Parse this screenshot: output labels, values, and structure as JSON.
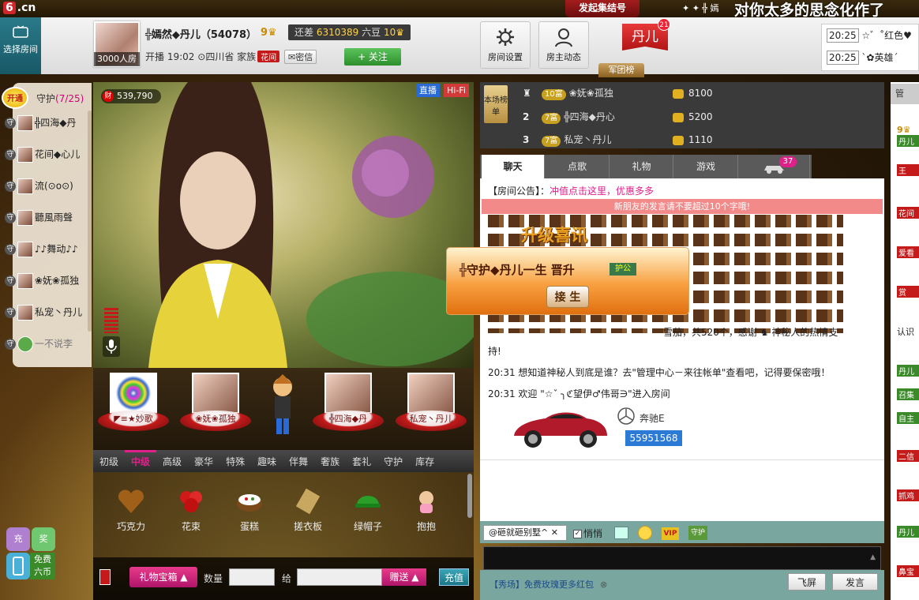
{
  "top": {
    "logo_text": ".cn",
    "rally_label": "发起集结号",
    "user_mini": "✦ ✦ ╬ 嫣",
    "marquee": "对你太多的思念化作了"
  },
  "header": {
    "select_room": "选择房间",
    "viewers": "3000人房",
    "anchor_name": "╬嫣然◆丹儿（54078）",
    "anchor_level": "9",
    "upgrade_prefix": "还差",
    "upgrade_amount": "6310389",
    "upgrade_unit": "六豆",
    "next_level": "10",
    "start_label": "开播",
    "start_time": "19:02",
    "location": "四川省",
    "family_label": "家族",
    "family_tag": "花间",
    "message_label": "密信",
    "follow_label": "+ 关注",
    "btn_room_settings": "房间设置",
    "btn_host_news": "房主动态",
    "danner": "丹儿",
    "danner_num": "21",
    "army_tab": "军团榜"
  },
  "ticker": [
    {
      "time": "20:25",
      "text": "☆゛˚红色♥"
    },
    {
      "time": "20:25",
      "text": "ˋ✿英雄ˊ"
    }
  ],
  "guard": {
    "open_label": "开通",
    "title": "守护",
    "count": "(7/25)",
    "rows": [
      "╬四海◆丹",
      "花间◆心儿",
      "流(⊙o⊙)",
      "聽風雨聲",
      "♪♪舞动♪♪",
      "❀妩❀孤独",
      "私宠丶丹儿",
      "一不说李"
    ]
  },
  "video": {
    "wealth": "539,790",
    "wealth_icon": "财",
    "live_tag": "直播",
    "hifi_tag": "Hi-Fi"
  },
  "seats": [
    "◤≡★妙歌",
    "❀妩❀孤独",
    "",
    "╬四海◆丹",
    "私宠丶丹儿"
  ],
  "gift_tabs": [
    "初级",
    "中级",
    "高级",
    "豪华",
    "特殊",
    "趣味",
    "伴舞",
    "奢族",
    "套礼",
    "守护",
    "库存"
  ],
  "gifts": [
    "巧克力",
    "花束",
    "蛋糕",
    "搓衣板",
    "绿帽子",
    "抱抱"
  ],
  "controls": {
    "gift_box": "礼物宝箱",
    "qty_label": "数量",
    "to_label": "给",
    "give": "赠送",
    "recharge": "充值",
    "charge_ico": "充",
    "award_ico": "奖",
    "free_coins_1": "免费",
    "free_coins_2": "六币"
  },
  "rank": {
    "badge": "本场榜单",
    "rows": [
      {
        "num": "",
        "level": "10富",
        "name": "❀妩❀孤独",
        "value": "8100"
      },
      {
        "num": "2",
        "level": "7富",
        "name": "╬四海◆丹心",
        "value": "5200"
      },
      {
        "num": "3",
        "level": "7富",
        "name": "私宠丶丹儿",
        "value": "1110"
      }
    ]
  },
  "chat": {
    "tabs": [
      "聊天",
      "点歌",
      "礼物",
      "游戏",
      ""
    ],
    "car_count": "37",
    "announce_label": "【房间公告】：",
    "announce_link": "冲值点击这里，优惠多多",
    "warning": "新朋友的发言请不要超过10个字哦!",
    "gift_line": "雪茄，共520个，感谢",
    "gift_thanks": "神秘人的热情支",
    "gift_line2": "持!",
    "sys1": "20:31 想知道神秘人到底是谁？去\"管理中心－来往帐单\"查看吧，记得要保密哦！",
    "sys2": "20:31 欢迎 \"☆ˇ ╮ℭ望伊♂伟哥∋\"进入房间",
    "car_brand": "奔驰E",
    "car_id": "55951568",
    "upgrade_title": "升级喜讯",
    "upgrade_text": "╬守护◆丹儿一生  晋升",
    "upgrade_level": "护公",
    "accept": "接 生"
  },
  "input": {
    "to_user": "@砸就砸别墅^",
    "quiet": "悄悄",
    "vip": "VIP",
    "guard": "守护",
    "promo": "【秀场】免费玫瑰更多红包",
    "promo_close": "⊗",
    "fly": "飞屏",
    "send": "发言"
  },
  "right_strip": {
    "tab": "管",
    "rows": [
      "丹儿",
      "王",
      "花间",
      "爱看",
      "赏",
      "认识",
      "丹儿",
      "召集",
      "自主",
      "二信",
      "抓鸡",
      "丹儿",
      "鼻宝"
    ]
  }
}
